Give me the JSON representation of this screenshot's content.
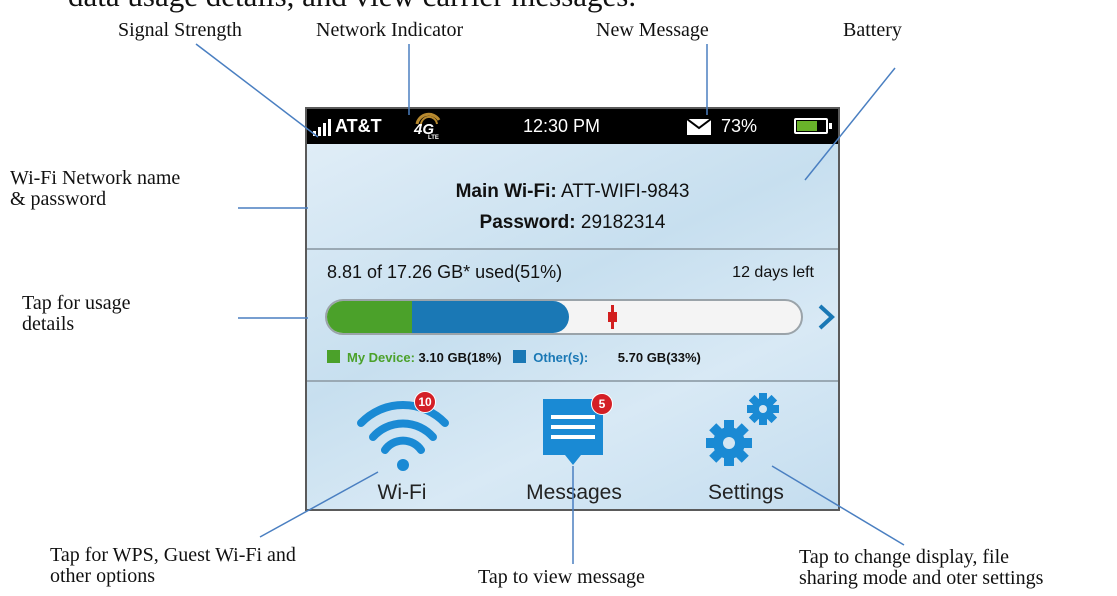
{
  "caption": "data usage details, and view carrier messages.",
  "labels": {
    "signal_strength": "Signal Strength",
    "network_indicator": "Network Indicator",
    "new_message": "New Message",
    "battery": "Battery",
    "wifi_network_line1": "Wi-Fi Network name",
    "wifi_network_line2": "& password",
    "usage_line1": "Tap for usage",
    "usage_line2": "details",
    "wps_line1": "Tap for WPS, Guest Wi-Fi and",
    "wps_line2": "other options",
    "view_message": "Tap to view message",
    "settings_line1": "Tap to change display, file",
    "settings_line2": "sharing mode and oter settings"
  },
  "status_bar": {
    "carrier": "AT&T",
    "network": "4G LTE",
    "time": "12:30 PM",
    "battery_percent": "73%",
    "battery_level": 0.73,
    "signal_icon": "signal-bars-icon",
    "mail_icon": "envelope-icon"
  },
  "wifi": {
    "name_label": "Main Wi-Fi:",
    "name_value": "ATT-WIFI-9843",
    "password_label": "Password:",
    "password_value": "29182314"
  },
  "usage": {
    "summary": "8.81 of 17.26 GB* used(51%)",
    "days_left": "12 days left",
    "my_device_fraction": 0.18,
    "others_fraction": 0.33,
    "marker_fraction": 0.6,
    "my_device_label": "My Device:",
    "my_device_value": "3.10 GB(18%)",
    "others_label": "Other(s):",
    "others_value": "5.70 GB(33%)"
  },
  "apps": [
    {
      "label": "Wi-Fi",
      "badge": "10",
      "icon": "wifi-icon"
    },
    {
      "label": "Messages",
      "badge": "5",
      "icon": "message-icon"
    },
    {
      "label": "Settings",
      "badge": "",
      "icon": "gears-icon"
    }
  ],
  "colors": {
    "my_device": "#4ba12a",
    "others": "#1a78b5",
    "icon_blue": "#1a8ad4",
    "badge_red": "#d41f26",
    "marker_red": "#d21f1f",
    "callout_line": "#4a7fc1"
  }
}
